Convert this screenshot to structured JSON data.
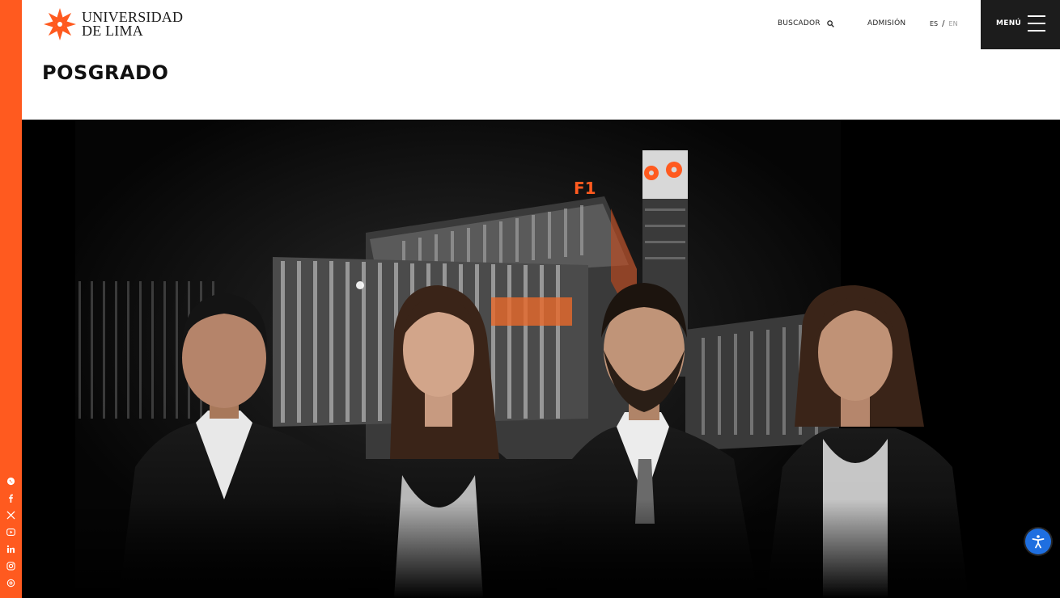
{
  "logo": {
    "line1": "UNIVERSIDAD",
    "line2": "DE LIMA",
    "color": "#ff5a1f"
  },
  "page": {
    "title": "POSGRADO"
  },
  "nav": {
    "search_label": "BUSCADOR",
    "admission_label": "ADMISIÓN",
    "lang_es": "ES",
    "lang_separator": "/",
    "lang_en": "EN",
    "menu_label": "MENÚ"
  },
  "hero": {
    "building_sign": "F1"
  },
  "social": [
    "whatsapp-icon",
    "facebook-icon",
    "x-icon",
    "youtube-icon",
    "linkedin-icon",
    "instagram-icon",
    "threads-icon"
  ],
  "colors": {
    "accent": "#ff5a1f",
    "menu_bg": "#1c1c1c",
    "accessibility": "#1f6fe0"
  }
}
